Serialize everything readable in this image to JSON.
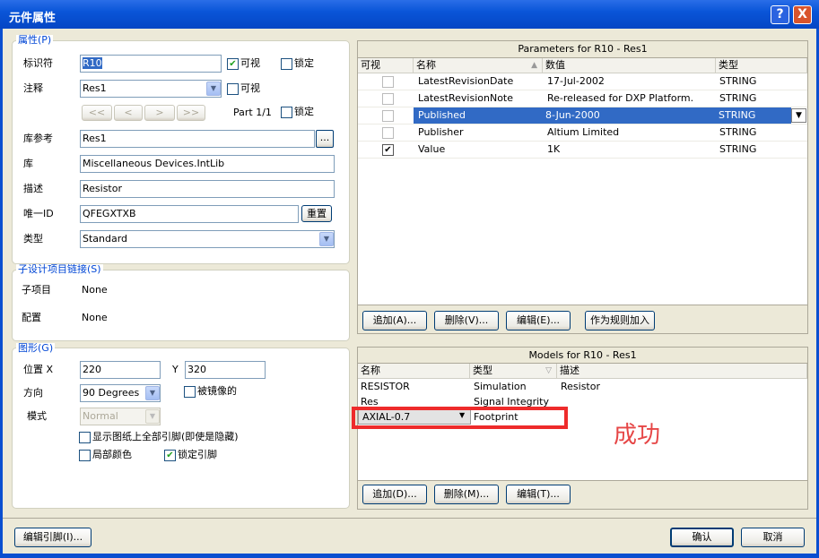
{
  "window": {
    "title": "元件属性",
    "help": "?",
    "close": "X"
  },
  "props": {
    "group_title": "属性(P)",
    "designator_label": "标识符",
    "designator_value": "R10",
    "visible_label": "可视",
    "locked_label": "锁定",
    "comment_label": "注释",
    "comment_value": "Res1",
    "comment_visible_label": "可视",
    "nav": [
      "<<",
      "<",
      ">",
      ">>"
    ],
    "part_text": "Part 1/1",
    "part_locked_label": "锁定",
    "libref_label": "库参考",
    "libref_value": "Res1",
    "libref_browse": "...",
    "library_label": "库",
    "library_value": "Miscellaneous Devices.IntLib",
    "desc_label": "描述",
    "desc_value": "Resistor",
    "uid_label": "唯一ID",
    "uid_value": "QFEGXTXB",
    "reset_label": "重置",
    "type_label": "类型",
    "type_value": "Standard"
  },
  "sub": {
    "group_title": "子设计项目链接(S)",
    "child_label": "子项目",
    "child_value": "None",
    "config_label": "配置",
    "config_value": "None"
  },
  "graphic": {
    "group_title": "图形(G)",
    "pos_label": "位置 X",
    "x_value": "220",
    "y_label": "Y",
    "y_value": "320",
    "orient_label": "方向",
    "orient_value": "90 Degrees",
    "mirror_label": "被镜像的",
    "mode_label": "模式",
    "mode_value": "Normal",
    "show_pins_label": "显示图纸上全部引脚(即使是隐藏)",
    "local_colors_label": "局部颜色",
    "lock_pins_label": "锁定引脚"
  },
  "params": {
    "title": "Parameters for R10 - Res1",
    "columns": [
      "可视",
      "名称",
      "数值",
      "类型"
    ],
    "rows": [
      {
        "visible": false,
        "name": "LatestRevisionDate",
        "value": "17-Jul-2002",
        "type": "STRING"
      },
      {
        "visible": false,
        "name": "LatestRevisionNote",
        "value": "Re-released for DXP Platform.",
        "type": "STRING"
      },
      {
        "visible": false,
        "name": "Published",
        "value": "8-Jun-2000",
        "type": "STRING"
      },
      {
        "visible": false,
        "name": "Publisher",
        "value": "Altium Limited",
        "type": "STRING"
      },
      {
        "visible": true,
        "name": "Value",
        "value": "1K",
        "type": "STRING"
      }
    ],
    "buttons": [
      "追加(A)...",
      "删除(V)...",
      "编辑(E)...",
      "作为规则加入"
    ]
  },
  "models": {
    "title": "Models for R10 - Res1",
    "columns": [
      "名称",
      "类型",
      "描述"
    ],
    "rows": [
      {
        "name": "RESISTOR",
        "type": "Simulation",
        "desc": "Resistor"
      },
      {
        "name": "Res",
        "type": "Signal Integrity",
        "desc": ""
      },
      {
        "name": "AXIAL-0.7",
        "type": "Footprint",
        "desc": ""
      }
    ],
    "buttons": [
      "追加(D)...",
      "删除(M)...",
      "编辑(T)..."
    ]
  },
  "annotation": {
    "text": "成功",
    "color": "#e64646"
  },
  "footer": {
    "edit_pins": "编辑引脚(I)...",
    "ok": "确认",
    "cancel": "取消"
  },
  "colors": {
    "selection": "#316ac5",
    "group_title": "#0046d5",
    "titlebar": "#0a55d8"
  }
}
